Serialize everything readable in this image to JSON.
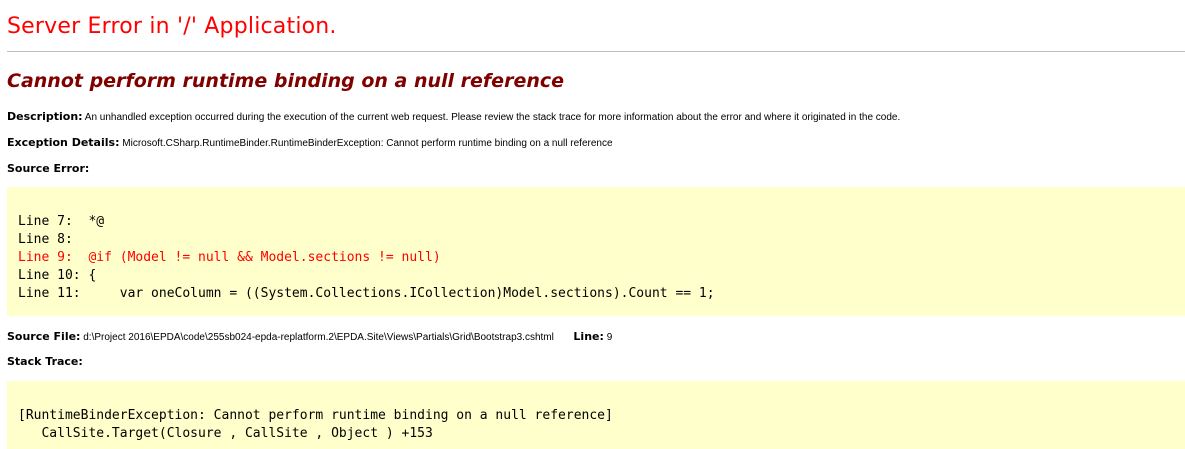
{
  "page": {
    "title": "Server Error in '/' Application.",
    "subtitle": "Cannot perform runtime binding on a null reference"
  },
  "description": {
    "label": "Description:",
    "text": "An unhandled exception occurred during the execution of the current web request. Please review the stack trace for more information about the error and where it originated in the code."
  },
  "exception": {
    "label": "Exception Details:",
    "text": "Microsoft.CSharp.RuntimeBinder.RuntimeBinderException: Cannot perform runtime binding on a null reference"
  },
  "source_error": {
    "label": "Source Error:",
    "lines": [
      "Line 7:  *@",
      "Line 8:",
      "Line 9:  @if (Model != null && Model.sections != null)",
      "Line 10: {",
      "Line 11:     var oneColumn = ((System.Collections.ICollection)Model.sections).Count == 1;"
    ],
    "error_line_index": 2
  },
  "source_file": {
    "label": "Source File:",
    "path": "d:\\Project 2016\\EPDA\\code\\255sb024-epda-replatform.2\\EPDA.Site\\Views\\Partials\\Grid\\Bootstrap3.cshtml",
    "line_label": "Line:",
    "line_number": "9"
  },
  "stack_trace": {
    "label": "Stack Trace:",
    "lines": [
      "[RuntimeBinderException: Cannot perform runtime binding on a null reference]",
      "   CallSite.Target(Closure , CallSite , Object ) +153"
    ]
  },
  "colors": {
    "title": "#ff0000",
    "subtitle": "#800000",
    "code_background": "#ffffcc",
    "error_line": "#ff0000"
  }
}
